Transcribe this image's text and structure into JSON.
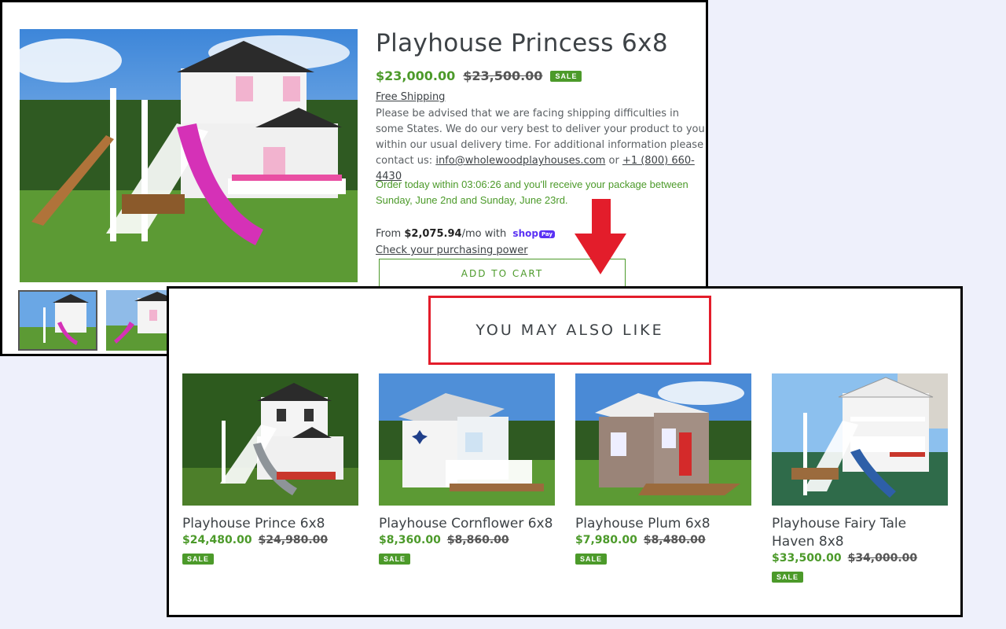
{
  "product": {
    "title": "Playhouse Princess 6x8",
    "price_sale": "$23,000.00",
    "price_original": "$23,500.00",
    "badge": "SALE",
    "free_shipping": "Free Shipping",
    "advisory": "Please be advised that we are facing shipping difficulties in some States. We do our very best to deliver your product to you within our usual delivery time. For additional information please contact us:",
    "email": "info@wholewoodplayhouses.com",
    "or_text": "or",
    "phone": "+1 (800) 660-4430",
    "order_message": "Order today within 03:06:26 and you'll receive your package between Sunday, June 2nd and Sunday, June 23rd.",
    "from_prefix": "From",
    "installment": "$2,075.94",
    "per_month_with": "/mo with",
    "shop_brand": "shop",
    "pay_brand": "Pay",
    "check_power": "Check your purchasing power",
    "add_to_cart": "ADD TO CART"
  },
  "recommendations": {
    "heading": "YOU MAY ALSO LIKE",
    "items": [
      {
        "name": "Playhouse Prince 6x8",
        "price_sale": "$24,480.00",
        "price_original": "$24,980.00",
        "badge": "SALE"
      },
      {
        "name": "Playhouse Cornflower 6x8",
        "price_sale": "$8,360.00",
        "price_original": "$8,860.00",
        "badge": "SALE"
      },
      {
        "name": "Playhouse Plum 6x8",
        "price_sale": "$7,980.00",
        "price_original": "$8,480.00",
        "badge": "SALE"
      },
      {
        "name": "Playhouse Fairy Tale Haven 8x8",
        "price_sale": "$33,500.00",
        "price_original": "$34,000.00",
        "badge": "SALE"
      }
    ]
  },
  "colors": {
    "accent_green": "#4c9a2a",
    "highlight_red": "#e31d2b",
    "shop_pay_purple": "#5a31f4"
  }
}
